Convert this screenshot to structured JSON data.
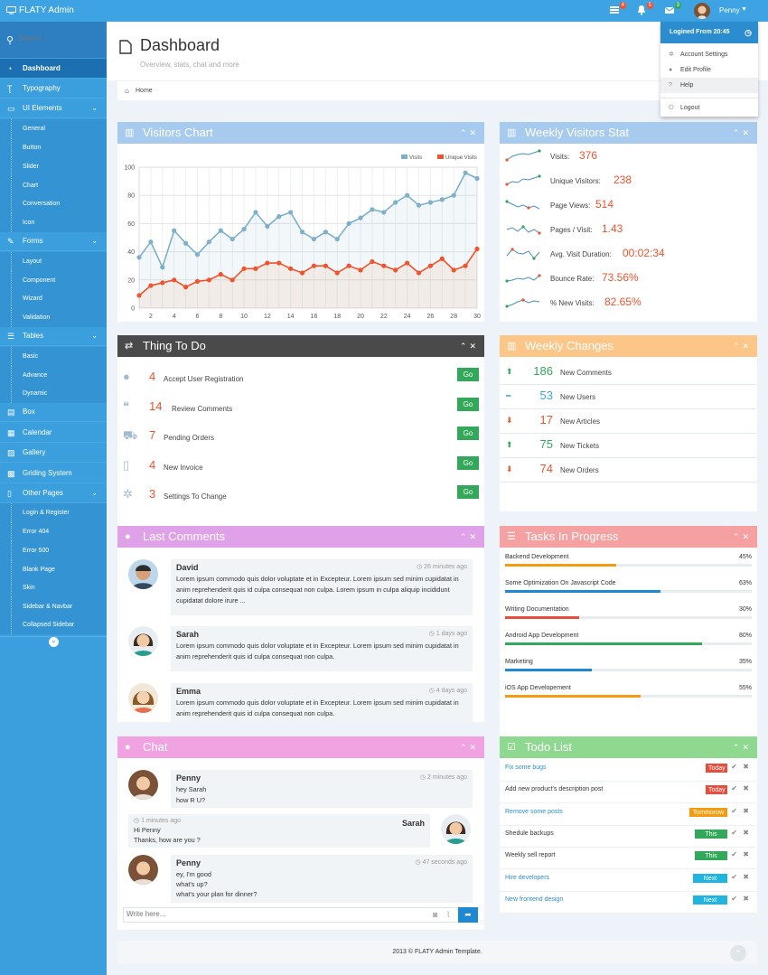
{
  "topbar": {
    "brand": "FLATY Admin",
    "badges": {
      "tasks": "4",
      "notifications": "5",
      "messages": "3"
    },
    "username": "Penny"
  },
  "user_menu": {
    "header": "Logined From 20:45",
    "items": [
      {
        "icon": "gear-icon",
        "label": "Account Settings"
      },
      {
        "icon": "user-icon",
        "label": "Edit Profile"
      },
      {
        "icon": "question-icon",
        "label": "Help"
      },
      {
        "icon": "power-icon",
        "label": "Logout"
      }
    ]
  },
  "sidebar": {
    "search_placeholder": "Search ...",
    "items": [
      {
        "label": "Dashboard",
        "icon": "dashboard-icon",
        "active": true
      },
      {
        "label": "Typography",
        "icon": "text-icon"
      },
      {
        "label": "UI Elements",
        "icon": "desktop-icon",
        "children": [
          "General",
          "Button",
          "Slider",
          "Chart",
          "Conversation",
          "Icon"
        ]
      },
      {
        "label": "Forms",
        "icon": "edit-icon",
        "children": [
          "Layout",
          "Component",
          "Wizard",
          "Validation"
        ]
      },
      {
        "label": "Tables",
        "icon": "table-icon",
        "children": [
          "Basic",
          "Advance",
          "Dynamic"
        ]
      },
      {
        "label": "Box",
        "icon": "box-icon"
      },
      {
        "label": "Calendar",
        "icon": "calendar-icon"
      },
      {
        "label": "Gallery",
        "icon": "picture-icon"
      },
      {
        "label": "Griding System",
        "icon": "grid-icon"
      },
      {
        "label": "Other Pages",
        "icon": "file-icon",
        "children": [
          "Login & Register",
          "Error 404",
          "Error 500",
          "Blank Page",
          "Skin",
          "Sidebar & Navbar",
          "Collapsed Sidebar"
        ]
      }
    ]
  },
  "page": {
    "title": "Dashboard",
    "subtitle": "Overview, stats, chat and more",
    "breadcrumb": "Home"
  },
  "visitors_chart": {
    "title": "Visitors Chart",
    "color": "#a7cbef"
  },
  "chart_data": {
    "type": "line",
    "x": [
      1,
      2,
      3,
      4,
      5,
      6,
      7,
      8,
      9,
      10,
      11,
      12,
      13,
      14,
      15,
      16,
      17,
      18,
      19,
      20,
      21,
      22,
      23,
      24,
      25,
      26,
      27,
      28,
      29,
      30
    ],
    "xticks": [
      2,
      4,
      6,
      8,
      10,
      12,
      14,
      16,
      18,
      20,
      22,
      24,
      26,
      28,
      30
    ],
    "ylim": [
      0,
      100
    ],
    "yticks": [
      0,
      20,
      40,
      60,
      80,
      100
    ],
    "grid": true,
    "legend": "top-right",
    "series": [
      {
        "name": "Visits",
        "color": "#7fb0c9",
        "values": [
          36,
          47,
          29,
          55,
          46,
          38,
          47,
          55,
          49,
          56,
          68,
          58,
          65,
          68,
          54,
          49,
          54,
          49,
          60,
          64,
          70,
          68,
          75,
          80,
          73,
          75,
          77,
          80,
          96,
          92
        ]
      },
      {
        "name": "Unique Visits",
        "color": "#f0532e",
        "values": [
          9,
          16,
          18,
          20,
          15,
          19,
          20,
          24,
          20,
          28,
          28,
          32,
          32,
          28,
          25,
          30,
          30,
          25,
          30,
          27,
          33,
          30,
          27,
          32,
          25,
          30,
          35,
          27,
          30,
          42
        ]
      }
    ]
  },
  "weekly_stats": {
    "title": "Weekly Visitors Stat",
    "color": "#a7cbef",
    "rows": [
      {
        "label": "Visits:",
        "value": "376"
      },
      {
        "label": "Unique Visitors:",
        "value": "238"
      },
      {
        "label": "Page Views:",
        "value": "514"
      },
      {
        "label": "Pages / Visit:",
        "value": "1.43"
      },
      {
        "label": "Avg. Visit Duration:",
        "value": "00:02:34"
      },
      {
        "label": "Bounce Rate:",
        "value": "73.56%"
      },
      {
        "label": "% New Visits:",
        "value": "82.65%"
      }
    ]
  },
  "things_todo": {
    "title": "Thing To Do",
    "go_label": "Go",
    "rows": [
      {
        "icon": "user-icon",
        "count": "4",
        "label": "Accept User Registration"
      },
      {
        "icon": "comments-icon",
        "count": "14",
        "label": "Review Comments"
      },
      {
        "icon": "cart-icon",
        "count": "7",
        "label": "Pending Orders"
      },
      {
        "icon": "file-icon",
        "count": "4",
        "label": "New Invoice"
      },
      {
        "icon": "gear-icon",
        "count": "3",
        "label": "Settings To Change"
      }
    ]
  },
  "weekly_changes": {
    "title": "Weekly Changes",
    "rows": [
      {
        "dir": "up",
        "value": "186",
        "label": "New Comments",
        "color": "#34a85a"
      },
      {
        "dir": "flat",
        "value": "53",
        "label": "New Users",
        "color": "#3ea3e2"
      },
      {
        "dir": "down",
        "value": "17",
        "label": "New Articles",
        "color": "#f0532e"
      },
      {
        "dir": "up",
        "value": "75",
        "label": "New Tickets",
        "color": "#34a85a"
      },
      {
        "dir": "down",
        "value": "74",
        "label": "New Orders",
        "color": "#f0532e"
      }
    ]
  },
  "last_comments": {
    "title": "Last Comments",
    "items": [
      {
        "name": "David",
        "time": "26 minutes ago",
        "text": "Lorem ipsum commodo quis dolor voluptate et in Excepteur. Lorem ipsum sed minim cupidatat in anim reprehenderit quis id culpa consequat non culpa. Lorem ipsum in culpa aliquip incididunt cupidatat dolore irure ..."
      },
      {
        "name": "Sarah",
        "time": "1 days ago",
        "text": "Lorem ipsum commodo quis dolor voluptate et in Excepteur. Lorem ipsum sed minim cupidatat in anim reprehenderit quis id culpa consequat non culpa."
      },
      {
        "name": "Emma",
        "time": "4 days ago",
        "text": "Lorem ipsum commodo quis dolor voluptate et in Excepteur. Lorem ipsum sed minim cupidatat in anim reprehenderit quis id culpa consequat non culpa."
      }
    ]
  },
  "tasks": {
    "title": "Tasks In Progress",
    "items": [
      {
        "name": "Backend Development",
        "pct": "45%",
        "value": 45,
        "color": "#f39c12"
      },
      {
        "name": "Some Optimization On Javascript Code",
        "pct": "63%",
        "value": 63,
        "color": "#1e88d2"
      },
      {
        "name": "Writing Documentation",
        "pct": "30%",
        "value": 30,
        "color": "#e74c3c"
      },
      {
        "name": "Android App Development",
        "pct": "80%",
        "value": 80,
        "color": "#34a85a"
      },
      {
        "name": "Marketing",
        "pct": "35%",
        "value": 35,
        "color": "#1e88d2"
      },
      {
        "name": "iOS App Developement",
        "pct": "55%",
        "value": 55,
        "color": "#f39c12"
      }
    ]
  },
  "chat": {
    "title": "Chat",
    "placeholder": "Write here...",
    "messages": [
      {
        "name": "Penny",
        "time": "2 minutes ago",
        "lines": [
          "hey Sarah",
          "how R U?"
        ]
      },
      {
        "name": "Sarah",
        "time": "1 minutes ago",
        "lines": [
          "Hi Penny",
          "Thanks, how are you ?"
        ]
      },
      {
        "name": "Penny",
        "time": "47 seconds ago",
        "lines": [
          "ey, I'm good",
          "what's up?",
          "what's your plan for dinner?"
        ]
      }
    ]
  },
  "todo_list": {
    "title": "Todo List",
    "items": [
      {
        "text": "Fix some bugs",
        "link": true,
        "tag": "Today",
        "tag_color": "#e74c3c"
      },
      {
        "text": "Add new product's description post",
        "link": false,
        "tag": "Today",
        "tag_color": "#e74c3c"
      },
      {
        "text": "Remove some posts",
        "link": true,
        "tag": "Tommorow",
        "tag_color": "#f39c12"
      },
      {
        "text": "Shedule backups",
        "link": false,
        "tag": "This week",
        "tag_color": "#34a85a"
      },
      {
        "text": "Weekly sell report",
        "link": false,
        "tag": "This week",
        "tag_color": "#34a85a"
      },
      {
        "text": "Hire developers",
        "link": true,
        "tag": "Next week",
        "tag_color": "#1fb5e0"
      },
      {
        "text": "New frontend design",
        "link": true,
        "tag": "Next week",
        "tag_color": "#1fb5e0"
      }
    ]
  },
  "footer": {
    "text": "2013 © FLATY Admin Template."
  }
}
